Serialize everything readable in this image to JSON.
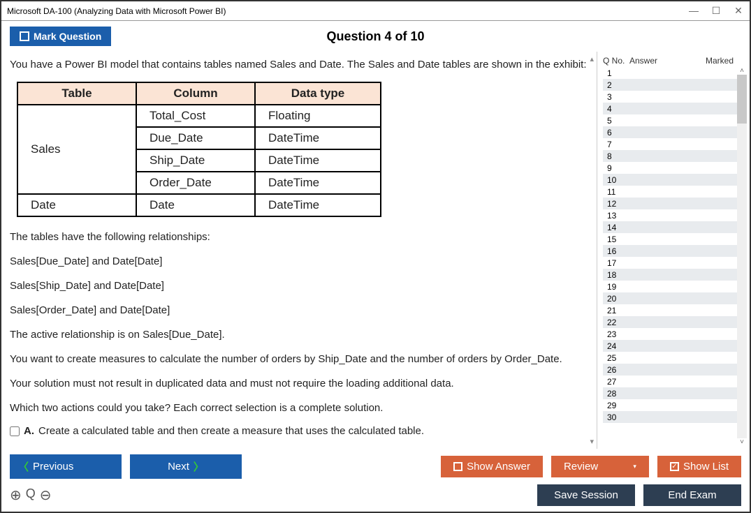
{
  "window": {
    "title": "Microsoft DA-100 (Analyzing Data with Microsoft Power BI)"
  },
  "header": {
    "mark_label": "Mark Question",
    "question_title": "Question 4 of 10"
  },
  "question": {
    "intro": "You have a Power BI model that contains tables named Sales and Date. The Sales and Date tables are shown in the exhibit:",
    "table_headers": {
      "table": "Table",
      "column": "Column",
      "datatype": "Data type"
    },
    "table_rows": {
      "sales_label": "Sales",
      "r1_col": "Total_Cost",
      "r1_dt": "Floating",
      "r2_col": "Due_Date",
      "r2_dt": "DateTime",
      "r3_col": "Ship_Date",
      "r3_dt": "DateTime",
      "r4_col": "Order_Date",
      "r4_dt": "DateTime",
      "date_label": "Date",
      "r5_col": "Date",
      "r5_dt": "DateTime"
    },
    "p2": "The tables have the following relationships:",
    "p3": "Sales[Due_Date] and Date[Date]",
    "p4": "Sales[Ship_Date] and Date[Date]",
    "p5": "Sales[Order_Date] and Date[Date]",
    "p6": "The active relationship is on Sales[Due_Date].",
    "p7": "You want to create measures to calculate the number of orders by Ship_Date and the number of orders by Order_Date.",
    "p8": "Your solution must not result in duplicated data and must not require the loading additional data.",
    "p9": "Which two actions could you take? Each correct selection is a complete solution.",
    "opt_a_prefix": "A.",
    "opt_a": "Create a calculated table and then create a measure that uses the calculated table."
  },
  "sidepanel": {
    "qno": "Q No.",
    "answer": "Answer",
    "marked": "Marked",
    "rows": [
      "1",
      "2",
      "3",
      "4",
      "5",
      "6",
      "7",
      "8",
      "9",
      "10",
      "11",
      "12",
      "13",
      "14",
      "15",
      "16",
      "17",
      "18",
      "19",
      "20",
      "21",
      "22",
      "23",
      "24",
      "25",
      "26",
      "27",
      "28",
      "29",
      "30"
    ]
  },
  "footer": {
    "previous": "Previous",
    "next": "Next",
    "show_answer": "Show Answer",
    "review": "Review",
    "show_list": "Show List",
    "save_session": "Save Session",
    "end_exam": "End Exam"
  }
}
